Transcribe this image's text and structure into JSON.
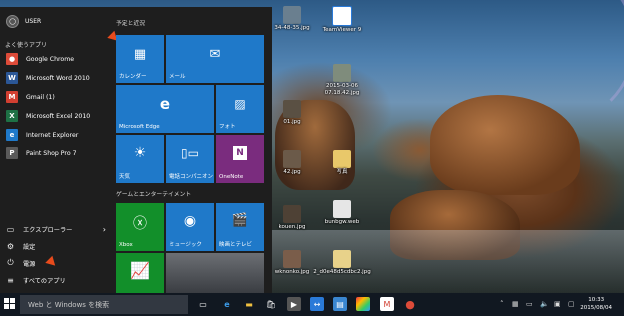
{
  "start_menu": {
    "user": "USER",
    "most_used_title": "よく使うアプリ",
    "apps": [
      {
        "label": "Google Chrome",
        "icon": "chrome-icon",
        "color": "#dd4b39",
        "glyph": "●"
      },
      {
        "label": "Microsoft Word 2010",
        "icon": "word-icon",
        "color": "#2b5797",
        "glyph": "W"
      },
      {
        "label": "Gmail (1)",
        "icon": "gmail-icon",
        "color": "#d23f31",
        "glyph": "M"
      },
      {
        "label": "Microsoft Excel 2010",
        "icon": "excel-icon",
        "color": "#1e7145",
        "glyph": "X"
      },
      {
        "label": "Internet Explorer",
        "icon": "ie-icon",
        "color": "#1f79c9",
        "glyph": "e"
      },
      {
        "label": "Paint Shop Pro 7",
        "icon": "paintshop-icon",
        "color": "#5a5a5a",
        "glyph": "P"
      }
    ],
    "bottom": [
      {
        "label": "エクスプローラー",
        "icon": "folder-icon",
        "glyph": "▭",
        "chevron": "›"
      },
      {
        "label": "設定",
        "icon": "gear-icon",
        "glyph": "⚙"
      },
      {
        "label": "電源",
        "icon": "power-icon",
        "glyph": "⏻"
      },
      {
        "label": "すべてのアプリ",
        "icon": "all-apps-icon",
        "glyph": "≡"
      }
    ],
    "tile_groups": {
      "schedule_title": "予定と近況",
      "games_title": "ゲームとエンターテイメント"
    },
    "tiles": {
      "calendar": "カレンダー",
      "mail": "メール",
      "edge": "Microsoft Edge",
      "photos": "フォト",
      "weather": "天気",
      "companion": "電話コンパニオン",
      "onenote": "OneNote",
      "xbox": "Xbox",
      "music": "ミュージック",
      "movies": "映画とテレビ"
    }
  },
  "desktop_icons": {
    "icon1": "34-48-35.jpg",
    "icon2": "TeamViewer 9",
    "icon3": "2015-03-06 07.18.42.jpg",
    "icon4": "01.jpg",
    "icon5": "写真",
    "icon6": "42.jpg",
    "icon7": "bunbgw.web",
    "icon8": "kouen.jpg",
    "icon9": "wknonko.jpg",
    "icon10": "2_d0e48d5cdbc2.jpg"
  },
  "taskbar": {
    "search_placeholder": "Web と Windows を検索",
    "time": "10:33",
    "date": "2015/08/04",
    "colors": {
      "bar": "#111821",
      "accent": "#1f79c9"
    }
  }
}
